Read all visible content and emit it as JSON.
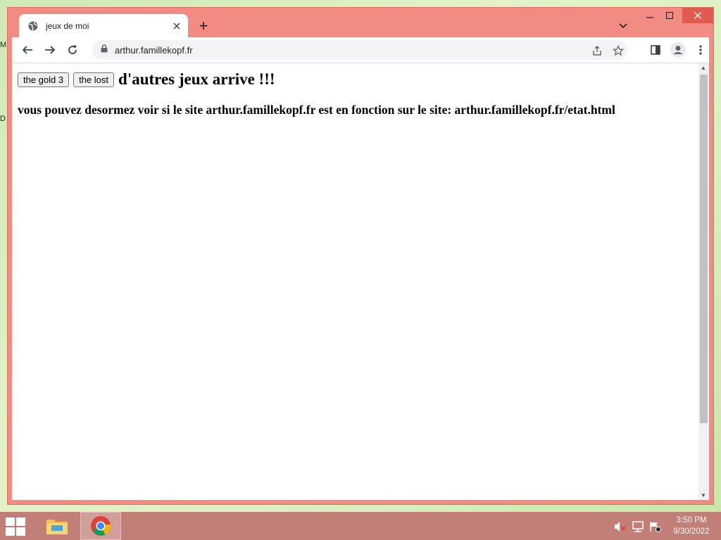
{
  "desktop": {
    "glyph_top": "M",
    "glyph_bottom": "D"
  },
  "browser": {
    "tab": {
      "title": "jeux de moi",
      "favicon": "globe-icon",
      "close": "close-icon"
    },
    "new_tab": "+",
    "window_controls": {
      "minimize": "minimize-icon",
      "maximize": "maximize-icon",
      "close": "close-icon"
    },
    "address_bar": {
      "url": "arthur.famillekopf.fr",
      "lock": "lock-icon"
    },
    "toolbar_icons": [
      "back-icon",
      "forward-icon",
      "reload-icon",
      "share-icon",
      "star-icon",
      "side-panel-icon",
      "profile-icon",
      "menu-icon"
    ],
    "accent_color": "#f28b82"
  },
  "page": {
    "buttons": [
      {
        "label": "the gold 3"
      },
      {
        "label": "the lost"
      }
    ],
    "heading": "d'autres jeux arrive !!!",
    "message": "vous pouvez desormez voir si le site arthur.famillekopf.fr est en fonction sur le site: arthur.famillekopf.fr/etat.html"
  },
  "taskbar": {
    "apps": [
      "start-icon",
      "file-explorer-icon",
      "chrome-icon"
    ],
    "tray": [
      "volume-muted-icon",
      "network-icon",
      "action-center-icon"
    ],
    "time": "3:50 PM",
    "date": "9/30/2022",
    "color": "#c27f78"
  }
}
